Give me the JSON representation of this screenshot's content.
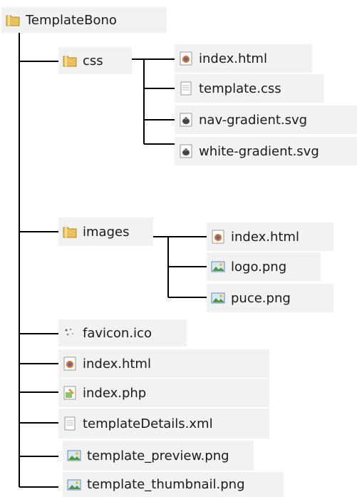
{
  "root": {
    "label": "TemplateBono",
    "icon": "folder-icon"
  },
  "folders": {
    "css": {
      "label": "css",
      "icon": "folder-icon",
      "children": [
        {
          "label": "index.html",
          "icon": "firefox-html-icon"
        },
        {
          "label": "template.css",
          "icon": "text-file-icon"
        },
        {
          "label": "nav-gradient.svg",
          "icon": "svg-file-icon"
        },
        {
          "label": "white-gradient.svg",
          "icon": "svg-file-icon"
        }
      ]
    },
    "images": {
      "label": "images",
      "icon": "folder-icon",
      "children": [
        {
          "label": "index.html",
          "icon": "firefox-html-icon"
        },
        {
          "label": "logo.png",
          "icon": "image-file-icon"
        },
        {
          "label": "puce.png",
          "icon": "image-file-icon"
        }
      ]
    }
  },
  "root_files": [
    {
      "label": "favicon.ico",
      "icon": "ico-file-icon"
    },
    {
      "label": "index.html",
      "icon": "firefox-html-icon"
    },
    {
      "label": "index.php",
      "icon": "php-file-icon"
    },
    {
      "label": "templateDetails.xml",
      "icon": "text-file-icon"
    },
    {
      "label": "template_preview.png",
      "icon": "image-file-icon"
    },
    {
      "label": "template_thumbnail.png",
      "icon": "image-file-icon"
    }
  ]
}
